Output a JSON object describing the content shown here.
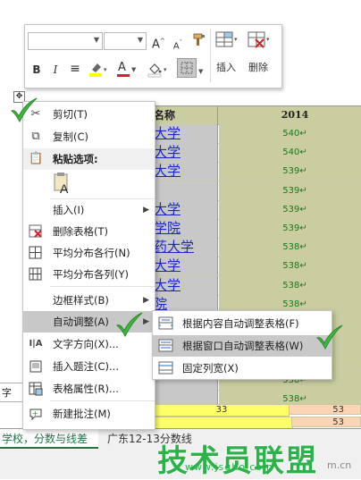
{
  "sheet": {
    "header_name": "名称",
    "header_year": "2014",
    "rows": [
      {
        "name": "大学",
        "value": "540↵"
      },
      {
        "name": "大学",
        "value": "540↵"
      },
      {
        "name": "大学",
        "value": "539↵"
      },
      {
        "name": "",
        "value": "539↵"
      },
      {
        "name": "大学",
        "value": "539↵"
      },
      {
        "name": "学院",
        "value": "539↵"
      },
      {
        "name": "药大学",
        "value": "538↵"
      },
      {
        "name": "大学",
        "value": "538↵"
      },
      {
        "name": "大学",
        "value": "538↵"
      },
      {
        "name": "院",
        "value": "538↵"
      },
      {
        "name": "",
        "value": "538↵"
      },
      {
        "name": "",
        "value": "538↵"
      },
      {
        "name": "",
        "value": "538↵"
      },
      {
        "name": "",
        "value": "538↵"
      },
      {
        "name": "",
        "value": "538↵"
      }
    ],
    "left_fragment": "字",
    "bottom_values": [
      "33",
      "53",
      "53"
    ],
    "tab_left": "学校，分数与线差",
    "tab_right": "广东12-13分数线",
    "watermark_big": "技术员联盟",
    "watermark_url": "www.jsgho.com",
    "watermark_small": "m.cn"
  },
  "toolbar": {
    "font_name": "",
    "font_size": "",
    "grow_font": "A",
    "shrink_font": "A",
    "bold": "B",
    "italic": "I",
    "font_color_letter": "A",
    "insert_label": "插入",
    "delete_label": "删除"
  },
  "context_menu": {
    "items": [
      {
        "label": "剪切(T)",
        "icon": "scissors-icon"
      },
      {
        "label": "复制(C)",
        "icon": "copy-icon"
      },
      {
        "label": "粘贴选项:",
        "icon": "paste-icon"
      },
      {
        "label": "插入(I)",
        "icon": "",
        "submenu": true
      },
      {
        "label": "删除表格(T)",
        "icon": "delete-table-icon"
      },
      {
        "label": "平均分布各行(N)",
        "icon": "distribute-rows-icon"
      },
      {
        "label": "平均分布各列(Y)",
        "icon": "distribute-columns-icon"
      },
      {
        "label": "边框样式(B)",
        "icon": "",
        "submenu": true
      },
      {
        "label": "自动调整(A)",
        "icon": "",
        "submenu": true
      },
      {
        "label": "文字方向(X)...",
        "icon": "text-direction-icon"
      },
      {
        "label": "插入题注(C)...",
        "icon": "insert-caption-icon"
      },
      {
        "label": "表格属性(R)...",
        "icon": "table-properties-icon"
      },
      {
        "label": "新建批注(M)",
        "icon": "new-comment-icon"
      }
    ],
    "paste_option_glyph": "A"
  },
  "submenu": {
    "items": [
      {
        "label": "根据内容自动调整表格(F)"
      },
      {
        "label": "根据窗口自动调整表格(W)"
      },
      {
        "label": "固定列宽(X)"
      }
    ]
  },
  "colors": {
    "highlight_gray": "#c8c8c8",
    "check_green": "#3fb83f",
    "link_blue": "#1a27c9",
    "cell_olive": "#c9cda0",
    "watermark_green": "#2bb34a"
  }
}
